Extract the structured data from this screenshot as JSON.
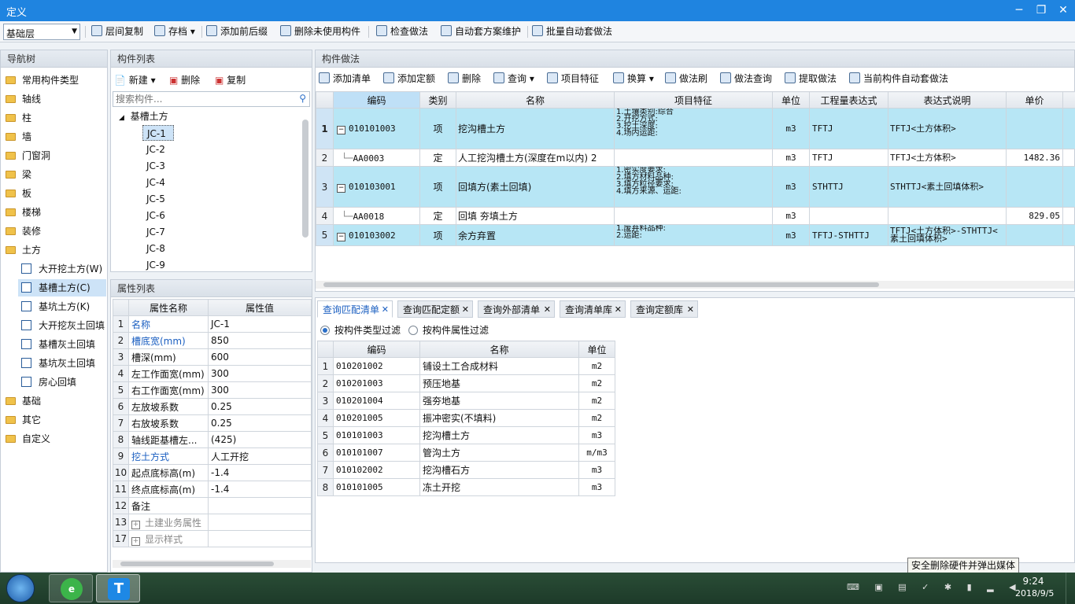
{
  "window": {
    "title": "定义"
  },
  "toolbar": {
    "floor": "基础层",
    "buttons": [
      "层间复制",
      "存档",
      "添加前后缀",
      "删除未使用构件",
      "检查做法",
      "自动套方案维护",
      "批量自动套做法"
    ]
  },
  "nav": {
    "title": "导航树",
    "items": [
      "常用构件类型",
      "轴线",
      "柱",
      "墙",
      "门窗洞",
      "梁",
      "板",
      "楼梯",
      "装修",
      "土方"
    ],
    "sub": [
      "大开挖土方(W)",
      "基槽土方(C)",
      "基坑土方(K)",
      "大开挖灰土回填",
      "基槽灰土回填",
      "基坑灰土回填",
      "房心回填"
    ],
    "items2": [
      "基础",
      "其它",
      "自定义"
    ]
  },
  "comp": {
    "title": "构件列表",
    "new": "新建",
    "del": "删除",
    "copy": "复制",
    "search_placeholder": "搜索构件...",
    "group": "基槽土方",
    "items": [
      "JC-1",
      "JC-2",
      "JC-3",
      "JC-4",
      "JC-5",
      "JC-6",
      "JC-7",
      "JC-8",
      "JC-9"
    ]
  },
  "props": {
    "title": "属性列表",
    "col_name": "属性名称",
    "col_val": "属性值",
    "rows": [
      {
        "n": "1",
        "name": "名称",
        "val": "JC-1"
      },
      {
        "n": "2",
        "name": "槽底宽(mm)",
        "val": "850"
      },
      {
        "n": "3",
        "name": "槽深(mm)",
        "val": "600"
      },
      {
        "n": "4",
        "name": "左工作面宽(mm)",
        "val": "300"
      },
      {
        "n": "5",
        "name": "右工作面宽(mm)",
        "val": "300"
      },
      {
        "n": "6",
        "name": "左放坡系数",
        "val": "0.25"
      },
      {
        "n": "7",
        "name": "右放坡系数",
        "val": "0.25"
      },
      {
        "n": "8",
        "name": "轴线距基槽左...",
        "val": "(425)"
      },
      {
        "n": "9",
        "name": "挖土方式",
        "val": "人工开挖"
      },
      {
        "n": "10",
        "name": "起点底标高(m)",
        "val": "-1.4"
      },
      {
        "n": "11",
        "name": "终点底标高(m)",
        "val": "-1.4"
      },
      {
        "n": "12",
        "name": "备注",
        "val": ""
      },
      {
        "n": "13",
        "name": "土建业务属性",
        "val": ""
      },
      {
        "n": "17",
        "name": "显示样式",
        "val": ""
      }
    ]
  },
  "method": {
    "title": "构件做法",
    "buttons": [
      "添加清单",
      "添加定额",
      "删除",
      "查询",
      "项目特征",
      "换算",
      "做法刷",
      "做法查询",
      "提取做法",
      "当前构件自动套做法"
    ],
    "headers": [
      "编码",
      "类别",
      "名称",
      "项目特征",
      "单位",
      "工程量表达式",
      "表达式说明",
      "单价"
    ],
    "rows": [
      {
        "n": "1",
        "code": "010101003",
        "type": "项",
        "name": "挖沟槽土方",
        "feat": [
          "1.土壤类别:综合",
          "2.开挖方式:",
          "3.挖土深度:",
          "4.场内运距:"
        ],
        "unit": "m3",
        "expr": "TFTJ",
        "desc": "TFTJ<土方体积>",
        "price": ""
      },
      {
        "n": "2",
        "code": "AA0003",
        "type": "定",
        "name": "人工挖沟槽土方(深度在m以内) 2",
        "feat": [],
        "unit": "m3",
        "expr": "TFTJ",
        "desc": "TFTJ<土方体积>",
        "price": "1482.36"
      },
      {
        "n": "3",
        "code": "010103001",
        "type": "项",
        "name": "回填方(素土回填)",
        "feat": [
          "1.密实度要求:",
          "2.填方材料品种:",
          "3.填方粒径要求:",
          "4.填方来源、运距:"
        ],
        "unit": "m3",
        "expr": "STHTTJ",
        "desc": "STHTTJ<素土回填体积>",
        "price": ""
      },
      {
        "n": "4",
        "code": "AA0018",
        "type": "定",
        "name": "回填 夯填土方",
        "feat": [],
        "unit": "m3",
        "expr": "",
        "desc": "",
        "price": "829.05"
      },
      {
        "n": "5",
        "code": "010103002",
        "type": "项",
        "name": "余方弃置",
        "feat": [
          "1.废弃料品种:",
          "2.运距:"
        ],
        "unit": "m3",
        "expr": "TFTJ-STHTTJ",
        "desc": "TFTJ<土方体积>-STHTTJ<素土回填体积>",
        "price": ""
      }
    ]
  },
  "query": {
    "tabs": [
      "查询匹配清单",
      "查询匹配定额",
      "查询外部清单",
      "查询清单库",
      "查询定额库"
    ],
    "filter1": "按构件类型过滤",
    "filter2": "按构件属性过滤",
    "headers": [
      "编码",
      "名称",
      "单位"
    ],
    "rows": [
      {
        "n": "1",
        "code": "010201002",
        "name": "铺设土工合成材料",
        "unit": "m2"
      },
      {
        "n": "2",
        "code": "010201003",
        "name": "预压地基",
        "unit": "m2"
      },
      {
        "n": "3",
        "code": "010201004",
        "name": "强夯地基",
        "unit": "m2"
      },
      {
        "n": "4",
        "code": "010201005",
        "name": "振冲密实(不填料)",
        "unit": "m2"
      },
      {
        "n": "5",
        "code": "010101003",
        "name": "挖沟槽土方",
        "unit": "m3"
      },
      {
        "n": "6",
        "code": "010101007",
        "name": "管沟土方",
        "unit": "m/m3"
      },
      {
        "n": "7",
        "code": "010102002",
        "name": "挖沟槽石方",
        "unit": "m3"
      },
      {
        "n": "8",
        "code": "010101005",
        "name": "冻土开挖",
        "unit": "m3"
      }
    ]
  },
  "tooltip": "安全删除硬件并弹出媒体",
  "clock": {
    "time": "9:24",
    "date": "2018/9/5"
  }
}
